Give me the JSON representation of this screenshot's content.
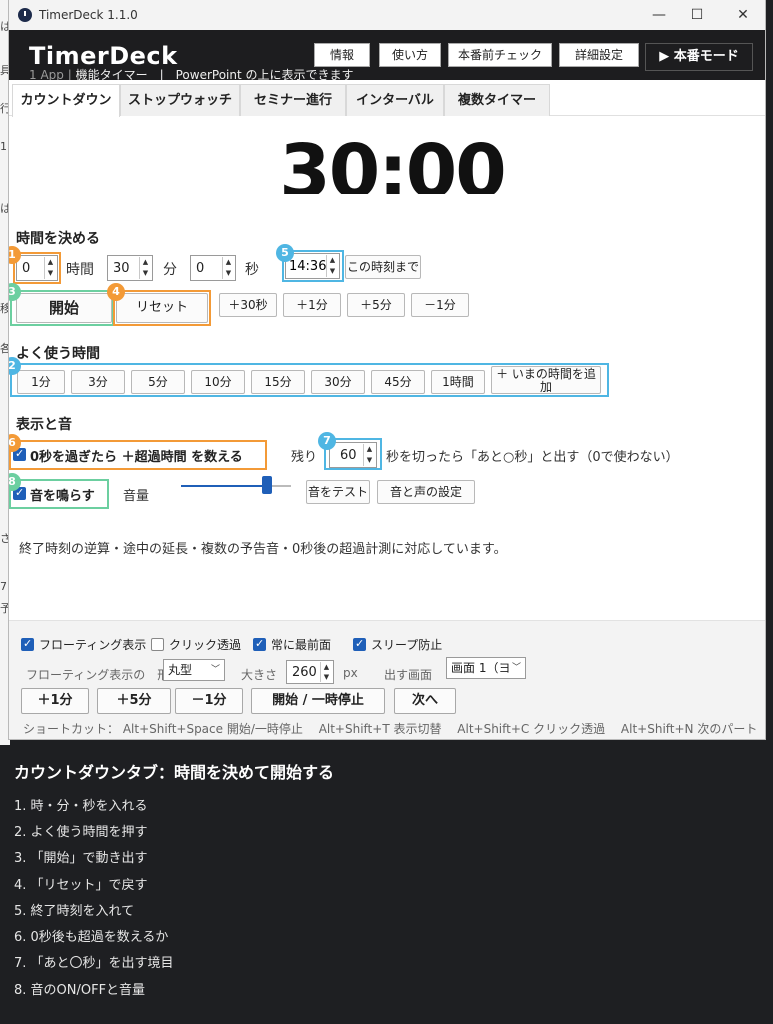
{
  "window": {
    "title": "TimerDeck 1.1.0",
    "minimize": "—",
    "maximize": "☐",
    "close": "✕"
  },
  "background_app": {
    "fragments": [
      "は",
      "具",
      "行",
      "1",
      "は",
      "移",
      "各",
      "さ",
      "7",
      "予"
    ]
  },
  "header": {
    "brand": "TimerDeck",
    "subtitle_faint": "1 App   |",
    "subtitle": "機能タイマー　|　PowerPoint の上に表示できます",
    "buttons": [
      "情報",
      "使い方",
      "本番前チェック",
      "詳細設定"
    ],
    "mode_button": "▶ 本番モード"
  },
  "tabs": [
    "カウントダウン",
    "ストップウォッチ",
    "セミナー進行",
    "インターバル",
    "複数タイマー"
  ],
  "timer": {
    "display": "30:00"
  },
  "set_time": {
    "heading": "時間を決める",
    "hours_value": "0",
    "hours_label": "時間",
    "minutes_value": "30",
    "minutes_label": "分",
    "seconds_value": "0",
    "seconds_label": "秒",
    "end_time_value": "14:36",
    "until_button": "この時刻まで"
  },
  "controls": {
    "start": "開始",
    "reset": "リセット",
    "adjust": [
      "＋30秒",
      "＋1分",
      "＋5分",
      "－1分"
    ]
  },
  "presets": {
    "heading": "よく使う時間",
    "items": [
      "1分",
      "3分",
      "5分",
      "10分",
      "15分",
      "30分",
      "45分",
      "1時間"
    ],
    "add_current": "＋ いまの時間を追加"
  },
  "display_sound": {
    "heading": "表示と音",
    "overtime_label": "0秒を過ぎたら ＋超過時間 を数える",
    "overtime_checked": true,
    "remaining_label": "残り",
    "remaining_value": "60",
    "remaining_suffix": "秒を切ったら「あと○秒」と出す（0で使わない）",
    "sound_label": "音を鳴らす",
    "sound_checked": true,
    "volume_label": "音量",
    "volume_level": 0.78,
    "test_sound": "音をテスト",
    "sound_settings": "音と声の設定"
  },
  "description": "終了時刻の逆算・途中の延長・複数の予告音・0秒後の超過計測に対応しています。",
  "bottom": {
    "floating": "フローティング表示",
    "click_through": "クリック透過",
    "always_on_top": "常に最前面",
    "prevent_sleep": "スリープ防止",
    "floating_checked": true,
    "click_through_checked": false,
    "always_on_top_checked": true,
    "prevent_sleep_checked": true,
    "shape_label": "フローティング表示の　形",
    "shape_value": "丸型",
    "size_label": "大きさ",
    "size_value": "260",
    "size_unit": "px",
    "screen_label": "出す画面",
    "screen_value": "画面 1（ヨ",
    "buttons": [
      "＋1分",
      "＋5分",
      "－1分",
      "開始 / 一時停止",
      "次へ"
    ],
    "shortcuts": "ショートカット：  Alt+Shift+Space 開始/一時停止　 Alt+Shift+T 表示切替　 Alt+Shift+C クリック透過　 Alt+Shift+N 次のパート"
  },
  "badges": [
    "1",
    "2",
    "3",
    "4",
    "5",
    "6",
    "7",
    "8"
  ],
  "caption": {
    "title": "カウントダウンタブ：時間を決めて開始する",
    "items": [
      "1. 時・分・秒を入れる",
      "2. よく使う時間を押す",
      "3. 「開始」で動き出す",
      "4. 「リセット」で戻す",
      "5. 終了時刻を入れて",
      "6. 0秒後も超過を数えるか",
      "7. 「あと〇秒」を出す境目",
      "8. 音のON/OFFと音量"
    ]
  },
  "colors": {
    "header_bg": "#1d1d1f",
    "accent_blue": "#1f5fb8",
    "callout_orange": "#f39a37",
    "callout_blue": "#4fb6e3",
    "callout_green": "#6ccfa0"
  }
}
